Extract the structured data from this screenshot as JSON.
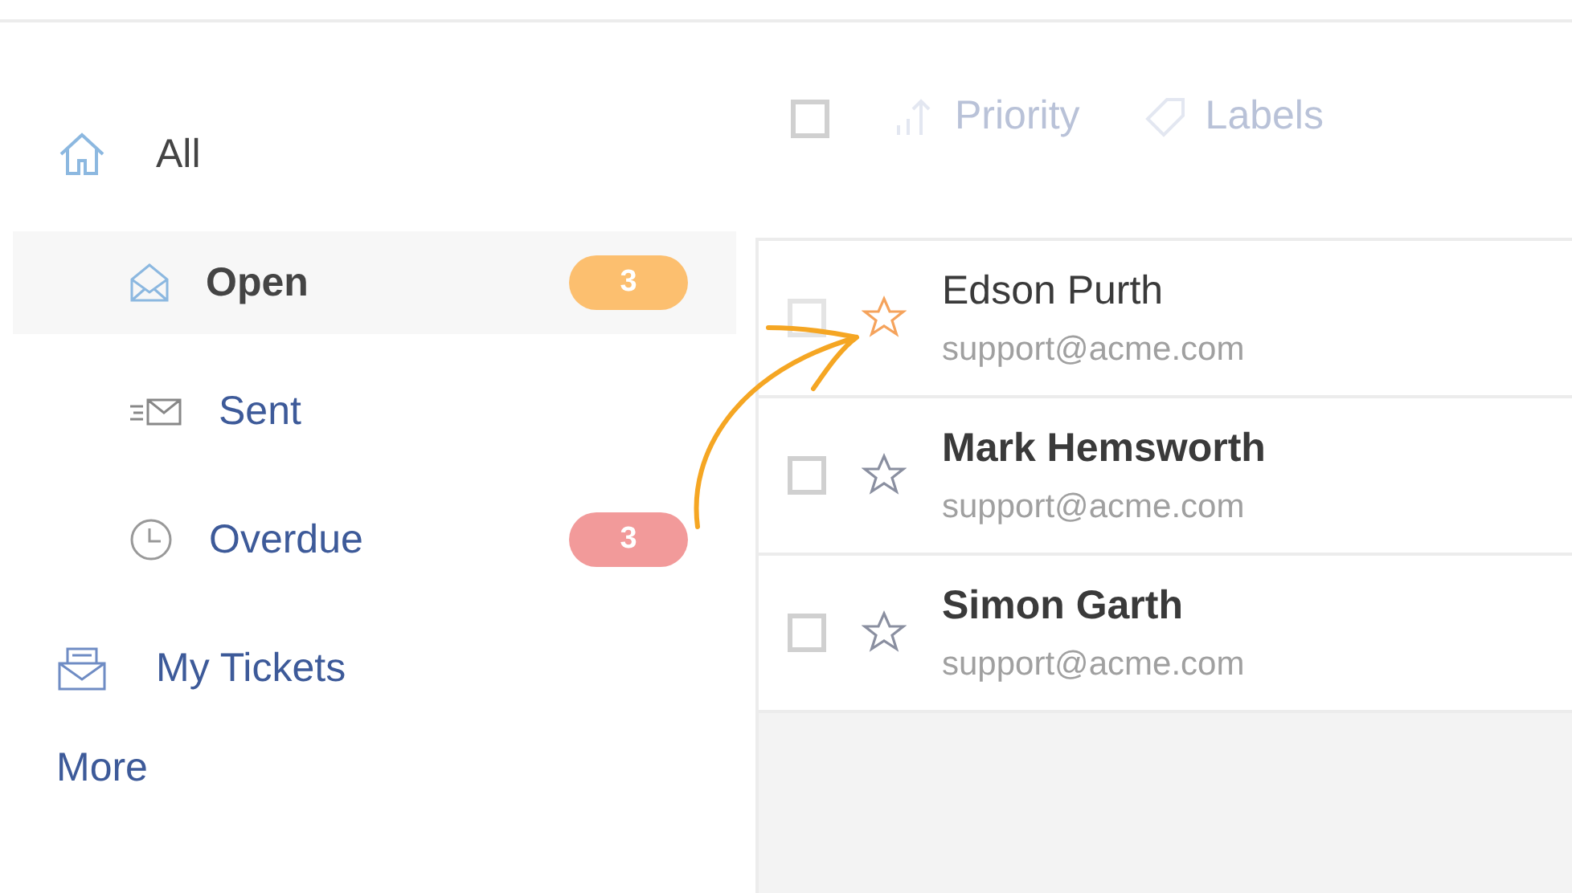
{
  "sidebar": {
    "items": [
      {
        "label": "All",
        "selected": false,
        "children": [
          {
            "label": "Open",
            "selected": true,
            "badge": {
              "text": "3",
              "color": "#fcbf6f"
            }
          },
          {
            "label": "Sent",
            "selected": false
          },
          {
            "label": "Overdue",
            "selected": false,
            "badge": {
              "text": "3",
              "color": "#f29a9a"
            }
          }
        ]
      },
      {
        "label": "My Tickets",
        "selected": false
      }
    ],
    "more": "More"
  },
  "toolbar": {
    "select_all": {
      "checked": false
    },
    "actions": [
      {
        "label": "Priority",
        "disabled": true
      },
      {
        "label": "Labels",
        "disabled": true
      }
    ]
  },
  "tickets": [
    {
      "name": "Edson Purth",
      "email": "support@acme.com",
      "checked": false,
      "unread": false,
      "highlighted": true
    },
    {
      "name": "Mark Hemsworth",
      "email": "support@acme.com",
      "checked": false,
      "unread": true,
      "highlighted": false
    },
    {
      "name": "Simon Garth",
      "email": "support@acme.com",
      "checked": false,
      "unread": true,
      "highlighted": false
    }
  ],
  "annotation": {
    "kind": "arrow"
  }
}
